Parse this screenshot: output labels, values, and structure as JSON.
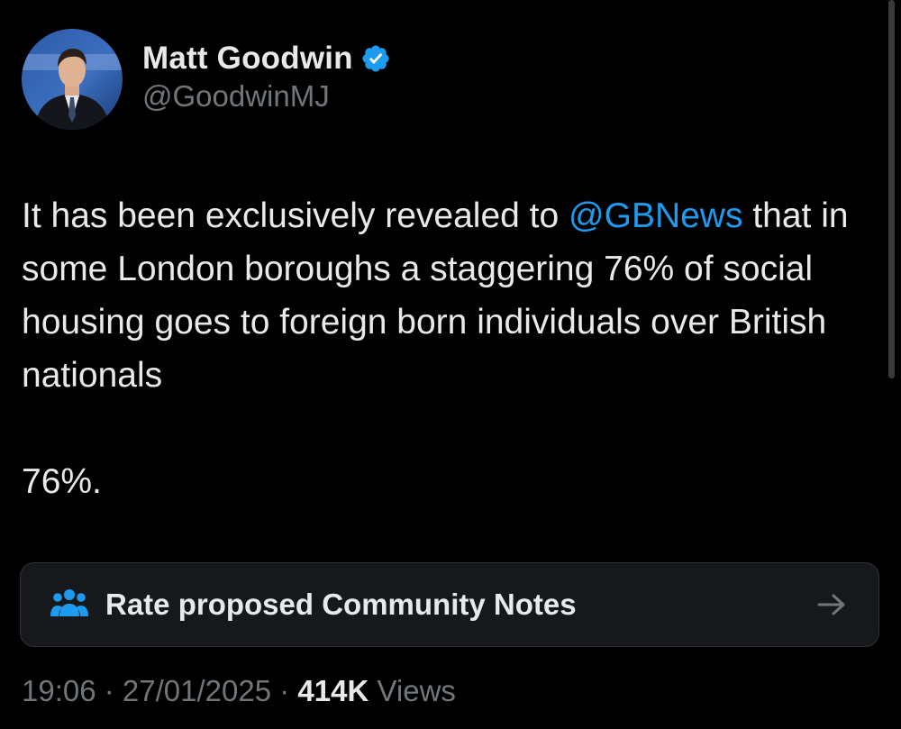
{
  "author": {
    "display_name": "Matt Goodwin",
    "handle": "@GoodwinMJ",
    "verified": true,
    "verified_color": "#1d9bf0",
    "avatar_icon": "profile-photo"
  },
  "tweet": {
    "text_before_mention": "It has been exclusively revealed to ",
    "mention": "@GBNews",
    "text_after_mention": " that in some London boroughs a staggering 76% of social housing goes to foreign born individuals over British nationals",
    "second_paragraph": "76%."
  },
  "community_notes": {
    "label": "Rate proposed Community Notes",
    "icon": "people-icon",
    "arrow_icon": "arrow-right-icon"
  },
  "meta": {
    "time": "19:06",
    "separator1": " · ",
    "date": "27/01/2025",
    "separator2": " · ",
    "views_count": "414K",
    "views_label": " Views"
  },
  "colors": {
    "background": "#000000",
    "text": "#e7e9ea",
    "secondary": "#71767b",
    "link": "#1d9bf0",
    "card_bg": "#16181c",
    "card_border": "#2f3336"
  }
}
